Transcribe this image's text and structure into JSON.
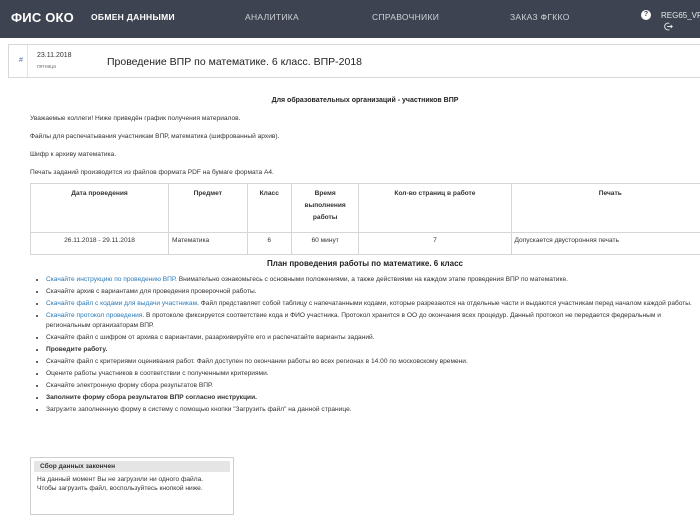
{
  "header": {
    "logo": "ФИС ОКО",
    "nav": [
      "ОБМЕН ДАННЫМИ",
      "АНАЛИТИКА",
      "СПРАВОЧНИКИ",
      "ЗАКАЗ ФГККО"
    ],
    "help": "?",
    "user": "REG65_VP"
  },
  "event": {
    "date": "23.11.2018",
    "weekday": "пятница",
    "title": "Проведение ВПР по математике. 6 класс. ВПР-2018"
  },
  "intro": {
    "heading": "Для образовательных организаций - участников ВПР",
    "lines": [
      "Уважаемые коллеги! Ниже приведён график получения материалов.",
      "Файлы для распечатывания участникам ВПР, математика (шифрованный архив).",
      "Шифр к архиву математика.",
      "Печать заданий производится из файлов формата PDF на бумаге формата А4."
    ]
  },
  "schedule": {
    "headers": [
      "Дата проведения",
      "Предмет",
      "Класс",
      "Время выполнения работы",
      "Кол-во страниц в работе",
      "Печать"
    ],
    "row": [
      "26.11.2018 - 29.11.2018",
      "Математика",
      "6",
      "60 минут",
      "7",
      "Допускается двусторонняя печать"
    ]
  },
  "plan": {
    "title": "План проведения работы по математике. 6 класс",
    "items": [
      {
        "link": "Скачайте инструкцию по проведению ВПР",
        "text": ". Внимательно ознакомьтесь с основными положениями, а также действиями на каждом этапе проведения ВПР по математике."
      },
      {
        "text": "Скачайте архив с вариантами для проведения проверочной работы."
      },
      {
        "link": "Скачайте файл с кодами для выдачи участникам",
        "text": ". Файл представляет собой таблицу с напечатанными кодами, которые разрезаются на отдельные части и выдаются участникам перед началом каждой работы."
      },
      {
        "link": "Скачайте протокол проведения",
        "text": ". В протоколе фиксируется соответствие кода и ФИО участника. Протокол хранится в ОО до окончания всех процедур. Данный протокол не передается федеральным и региональным организаторам ВПР."
      },
      {
        "text": "Скачайте файл с шифром от архива с вариантами, разархивируйте его и распечатайте варианты заданий."
      },
      {
        "bold": "Проведите работу."
      },
      {
        "text": "Скачайте файл с критериями оценивания работ. Файл доступен по окончании работы во всех регионах в 14.00 по московскому времени."
      },
      {
        "text": "Оцените работы участников в соответствии с полученными критериями."
      },
      {
        "text": "Скачайте электронную форму сбора результатов ВПР."
      },
      {
        "bold": "Заполните форму сбора результатов ВПР согласно инструкции."
      },
      {
        "text": "Загрузите заполненную форму в систему с помощью кнопки \"Загрузить файл\" на данной странице."
      }
    ]
  },
  "panel": {
    "title": "Сбор данных закончен",
    "line1": "На данный момент Вы не загрузили ни одного файла.",
    "line2": "Чтобы загрузить файл, воспользуйтесь кнопкой ниже."
  }
}
